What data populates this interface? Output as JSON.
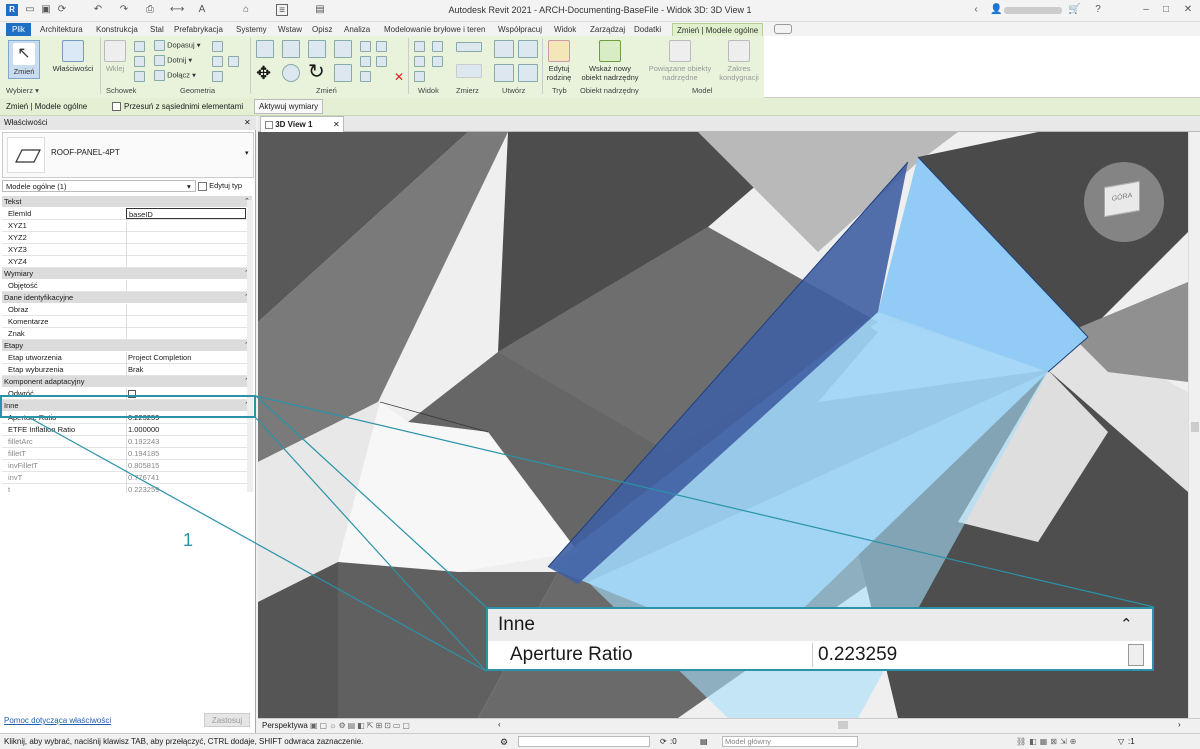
{
  "titlebar": {
    "title": "Autodesk Revit 2021 - ARCH-Documenting-BaseFile - Widok 3D: 3D View 1"
  },
  "tabs": [
    "Plik",
    "Architektura",
    "Konstrukcja",
    "Stal",
    "Prefabrykacja",
    "Systemy",
    "Wstaw",
    "Opisz",
    "Analiza",
    "Modelowanie bryłowe i teren",
    "Współpracuj",
    "Widok",
    "Zarządzaj",
    "Dodatki",
    "Zmień | Modele ogólne"
  ],
  "ribbon": {
    "select": {
      "btn": "Zmień",
      "group": "Wybierz"
    },
    "properties": {
      "btn": "Właściwości"
    },
    "clipboard": {
      "paste": "Wklej",
      "group": "Schowek"
    },
    "geometry": {
      "join": "Dopasuj",
      "cut": "Dotnij",
      "connect": "Dołącz",
      "group": "Geometria"
    },
    "modify": {
      "group": "Zmień"
    },
    "view": {
      "group": "Widok"
    },
    "measure": {
      "group": "Zmierz"
    },
    "create": {
      "group": "Utwórz"
    },
    "mode": {
      "edit_family": "Edytuj rodzinę",
      "group": "Tryb"
    },
    "host": {
      "pick_new": "Wskaż nowy obiekt nadrzędny",
      "group": "Obiekt nadrzędny"
    },
    "model": {
      "related": "Powiązane obiekty nadrzędne",
      "scope": "Zakres kondygnacji",
      "group": "Model"
    }
  },
  "optbar": {
    "context": "Zmień | Modele ogólne",
    "move_with": "Przesuń z sąsiednimi elementami",
    "activate_dims": "Aktywuj wymiary"
  },
  "properties": {
    "header": "Właściwości",
    "type_name": "ROOF-PANEL-4PT",
    "filter": "Modele ogólne (1)",
    "edit_type": "Edytuj typ",
    "groups": [
      {
        "name": "Tekst",
        "rows": [
          {
            "k": "ElemId",
            "v": "baseID"
          },
          {
            "k": "XYZ1",
            "v": ""
          },
          {
            "k": "XYZ2",
            "v": ""
          },
          {
            "k": "XYZ3",
            "v": ""
          },
          {
            "k": "XYZ4",
            "v": ""
          }
        ]
      },
      {
        "name": "Wymiary",
        "rows": [
          {
            "k": "Objętość",
            "v": ""
          }
        ]
      },
      {
        "name": "Dane identyfikacyjne",
        "rows": [
          {
            "k": "Obraz",
            "v": ""
          },
          {
            "k": "Komentarze",
            "v": ""
          },
          {
            "k": "Znak",
            "v": ""
          }
        ]
      },
      {
        "name": "Etapy",
        "rows": [
          {
            "k": "Etap utworzenia",
            "v": "Project Completion"
          },
          {
            "k": "Etap wyburzenia",
            "v": "Brak"
          }
        ]
      },
      {
        "name": "Komponent adaptacyjny",
        "rows": [
          {
            "k": "Odwróć",
            "v": ""
          }
        ]
      },
      {
        "name": "Inne",
        "rows": [
          {
            "k": "Aperture Ratio",
            "v": "0.223259"
          },
          {
            "k": "ETFE Inflation Ratio",
            "v": "1.000000"
          },
          {
            "k": "filletArc",
            "v": "0.192243"
          },
          {
            "k": "filletT",
            "v": "0.194185"
          },
          {
            "k": "invFilletT",
            "v": "0.805815"
          },
          {
            "k": "invT",
            "v": "0.776741"
          },
          {
            "k": "t",
            "v": "0.223259"
          }
        ]
      }
    ],
    "help_link": "Pomoc dotycząca właściwości",
    "apply": "Zastosuj"
  },
  "view": {
    "tab": "3D View 1",
    "nav_cube": "GÓRA",
    "controls": "Perspektywa"
  },
  "callout": {
    "number": "1",
    "group": "Inne",
    "key": "Aperture Ratio",
    "value": "0.223259"
  },
  "status": {
    "hint": "Kliknij, aby wybrać, naciśnij klawisz TAB, aby przełączyć, CTRL dodaje, SHIFT odwraca zaznaczenie.",
    "zero": ":0",
    "model": "Model główny",
    "filter_count": ":1"
  }
}
